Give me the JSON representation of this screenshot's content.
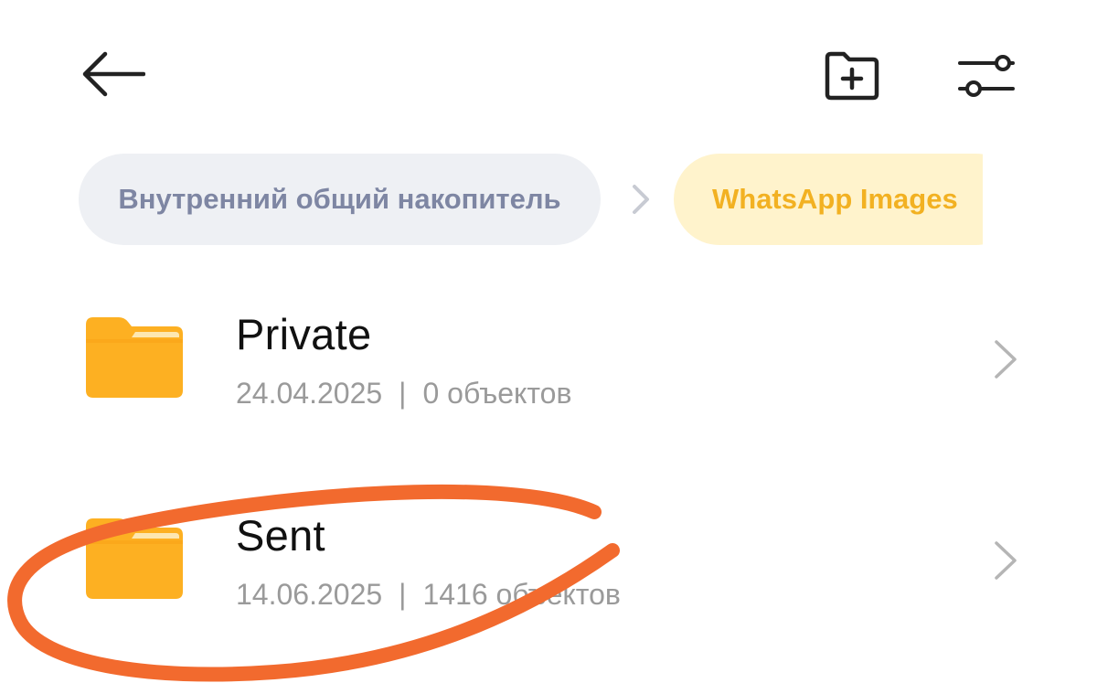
{
  "topbar": {
    "back_icon": "arrow-left-icon",
    "new_folder_icon": "folder-plus-icon",
    "filter_icon": "sliders-icon"
  },
  "breadcrumb": {
    "root": "Внутренний общий накопитель",
    "current": "WhatsApp Images",
    "separator_icon": "chevron-right-icon"
  },
  "files": [
    {
      "name": "Private",
      "date": "24.04.2025",
      "separator": "|",
      "count": "0 объектов"
    },
    {
      "name": "Sent",
      "date": "14.06.2025",
      "separator": "|",
      "count": "1416 объектов"
    }
  ],
  "colors": {
    "folder": "#fdb022",
    "folder_tab": "#f59a0e",
    "crumb_root_bg": "#eef0f4",
    "crumb_root_text": "#7e86a3",
    "crumb_current_bg": "#fff3cc",
    "crumb_current_text": "#f2b122",
    "annotation_stroke": "#f26a2e"
  },
  "annotation": {
    "type": "hand-drawn circle",
    "target": "Sent"
  }
}
